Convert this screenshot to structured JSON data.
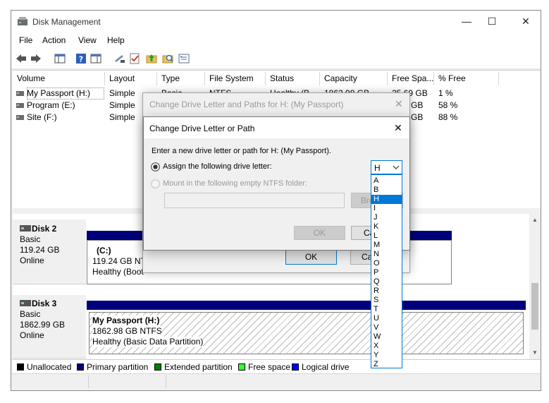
{
  "window": {
    "title": "Disk Management"
  },
  "menu": [
    "File",
    "Action",
    "View",
    "Help"
  ],
  "volume_list": {
    "columns": [
      "Volume",
      "Layout",
      "Type",
      "File System",
      "Status",
      "Capacity",
      "Free Spa...",
      "% Free"
    ],
    "rows": [
      {
        "volume": "My Passport (H:)",
        "layout": "Simple",
        "type": "Basic",
        "fs": "NTFS",
        "status": "Healthy (B...",
        "capacity": "1862.98 GB",
        "free": "25.69 GB",
        "pct": "1 %"
      },
      {
        "volume": "Program (E:)",
        "layout": "Simple",
        "free": "GB",
        "pct": "58 %"
      },
      {
        "volume": "Site (F:)",
        "layout": "Simple",
        "free": "GB",
        "pct": "88 %"
      }
    ]
  },
  "disks": [
    {
      "name": "Disk 2",
      "type": "Basic",
      "size": "119.24 GB",
      "state": "Online",
      "partition": {
        "title": "(C:)",
        "detail": "119.24 GB NTF",
        "status": "Healthy (Boot"
      }
    },
    {
      "name": "Disk 3",
      "type": "Basic",
      "size": "1862.99 GB",
      "state": "Online",
      "partition": {
        "title": "My Passport  (H:)",
        "detail": "1862.98 GB NTFS",
        "status": "Healthy (Basic Data Partition)"
      }
    }
  ],
  "legend": [
    {
      "label": "Unallocated",
      "color": "#000000"
    },
    {
      "label": "Primary partition",
      "color": "#00007b"
    },
    {
      "label": "Extended partition",
      "color": "#008000"
    },
    {
      "label": "Free space",
      "color": "#33ff33"
    },
    {
      "label": "Logical drive",
      "color": "#0000ff"
    }
  ],
  "dialog_outer": {
    "title": "Change Drive Letter and Paths for H: (My Passport)",
    "ok": "OK",
    "cancel": "Ca"
  },
  "dialog_inner": {
    "title": "Change Drive Letter or Path",
    "instruction": "Enter a new drive letter or path for H: (My Passport).",
    "option_assign": "Assign the following drive letter:",
    "option_mount": "Mount in the following empty NTFS folder:",
    "browse": "Bro",
    "ok": "OK",
    "cancel": "Ca",
    "selected_letter": "H",
    "letters": [
      "A",
      "B",
      "H",
      "I",
      "J",
      "K",
      "L",
      "M",
      "N",
      "O",
      "P",
      "Q",
      "R",
      "S",
      "T",
      "U",
      "V",
      "W",
      "X",
      "Y",
      "Z"
    ],
    "highlighted_index": 2
  }
}
